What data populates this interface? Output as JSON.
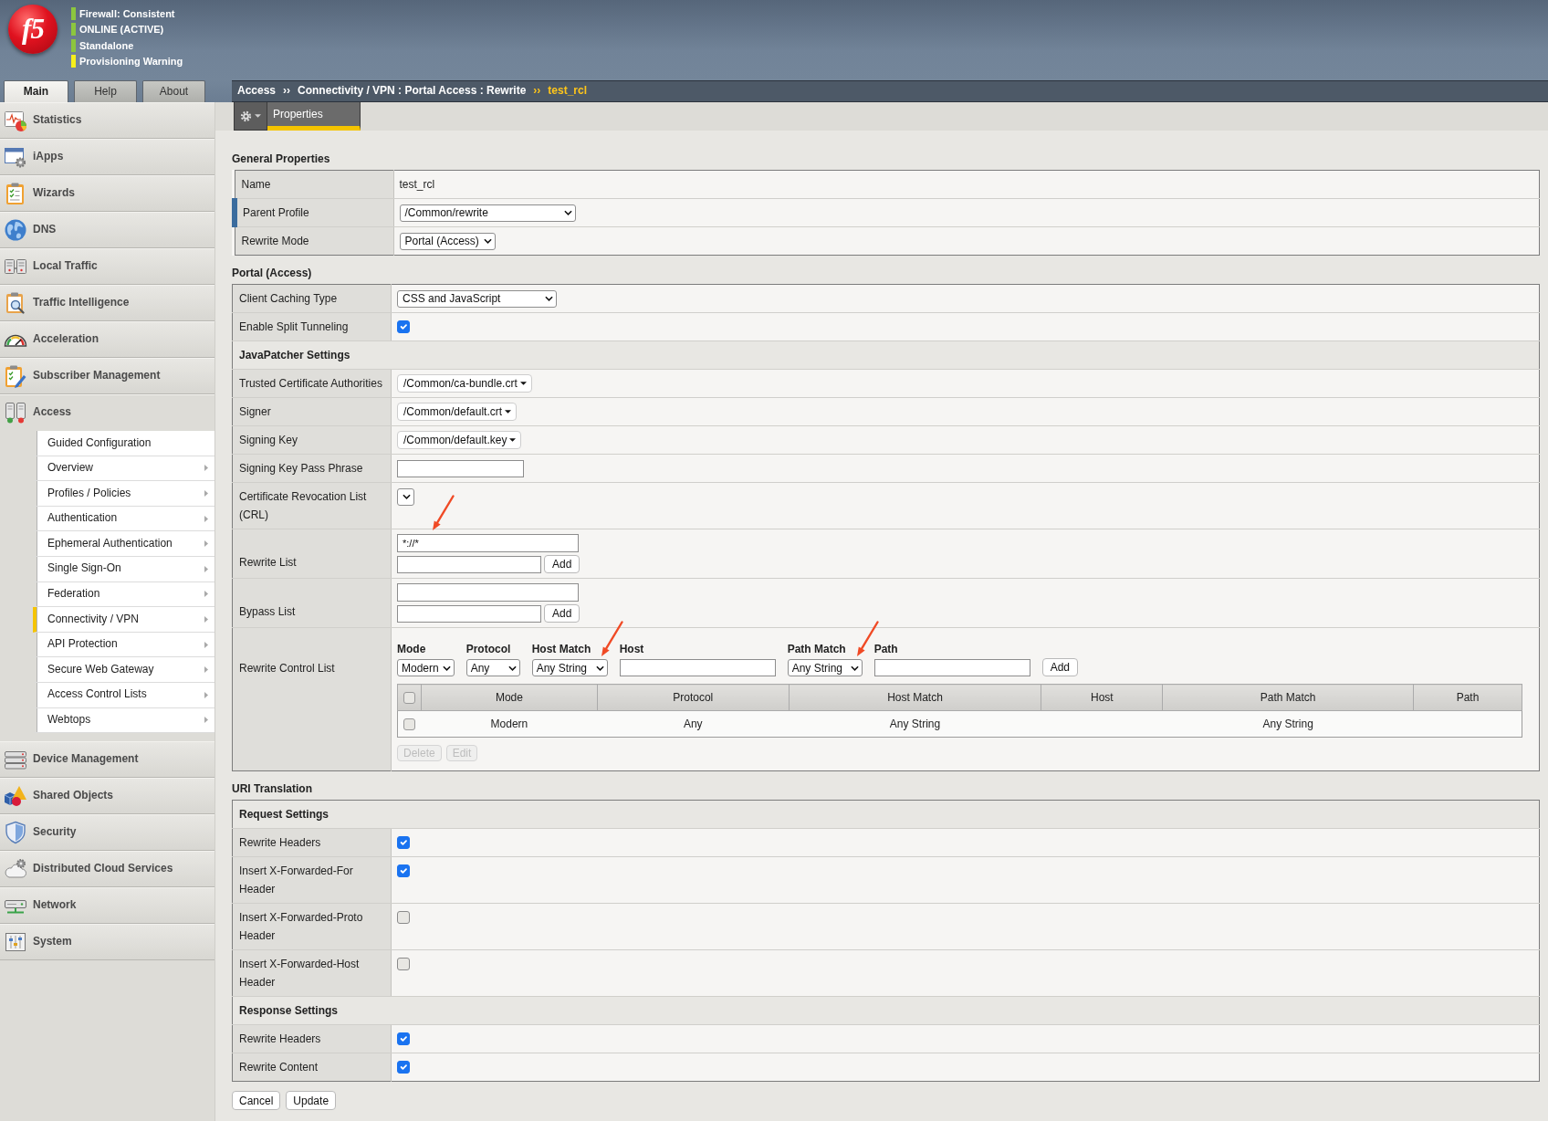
{
  "header": {
    "logo": "f5",
    "status": [
      {
        "text": "Firewall: Consistent",
        "color": "#8cc63e"
      },
      {
        "text": "ONLINE (ACTIVE)",
        "color": "#8cc63e"
      },
      {
        "text": "Standalone",
        "color": "#8cc63e"
      },
      {
        "text": "Provisioning Warning",
        "color": "#f6ef1b"
      }
    ]
  },
  "nav_tabs": [
    {
      "label": "Main",
      "selected": true
    },
    {
      "label": "Help",
      "selected": false
    },
    {
      "label": "About",
      "selected": false
    }
  ],
  "breadcrumb": [
    {
      "label": "Access",
      "current": false
    },
    {
      "separator": "››",
      "label": "Connectivity / VPN : Portal Access : Rewrite",
      "current": false
    },
    {
      "separator": "››",
      "label": "test_rcl",
      "current": true
    }
  ],
  "page_tabs": [
    {
      "label": "Properties",
      "selected": true
    }
  ],
  "sidebar": {
    "items": [
      {
        "label": "Statistics",
        "expanded": false
      },
      {
        "label": "iApps",
        "expanded": false
      },
      {
        "label": "Wizards",
        "expanded": false
      },
      {
        "label": "DNS",
        "expanded": false
      },
      {
        "label": "Local Traffic",
        "expanded": false
      },
      {
        "label": "Traffic Intelligence",
        "expanded": false
      },
      {
        "label": "Acceleration",
        "expanded": false
      },
      {
        "label": "Subscriber Management",
        "expanded": false
      },
      {
        "label": "Access",
        "expanded": true,
        "children": [
          {
            "label": "Guided Configuration",
            "selected": false,
            "has_submenu": false
          },
          {
            "label": "Overview",
            "selected": false,
            "has_submenu": true
          },
          {
            "label": "Profiles / Policies",
            "selected": false,
            "has_submenu": true
          },
          {
            "label": "Authentication",
            "selected": false,
            "has_submenu": true
          },
          {
            "label": "Ephemeral Authentication",
            "selected": false,
            "has_submenu": true
          },
          {
            "label": "Single Sign-On",
            "selected": false,
            "has_submenu": true
          },
          {
            "label": "Federation",
            "selected": false,
            "has_submenu": true
          },
          {
            "label": "Connectivity / VPN",
            "selected": true,
            "has_submenu": true
          },
          {
            "label": "API Protection",
            "selected": false,
            "has_submenu": true
          },
          {
            "label": "Secure Web Gateway",
            "selected": false,
            "has_submenu": true
          },
          {
            "label": "Access Control Lists",
            "selected": false,
            "has_submenu": true
          },
          {
            "label": "Webtops",
            "selected": false,
            "has_submenu": true
          }
        ]
      },
      {
        "label": "Device Management",
        "expanded": false
      },
      {
        "label": "Shared Objects",
        "expanded": false
      },
      {
        "label": "Security",
        "expanded": false
      },
      {
        "label": "Distributed Cloud Services",
        "expanded": false
      },
      {
        "label": "Network",
        "expanded": false
      },
      {
        "label": "System",
        "expanded": false
      }
    ]
  },
  "sections": [
    {
      "title": "General Properties",
      "rows": [
        {
          "kind": "text",
          "label": "Name",
          "value": "test_rcl",
          "highlighted": false
        },
        {
          "kind": "select",
          "label": "Parent Profile",
          "value": "/Common/rewrite",
          "highlighted": true
        },
        {
          "kind": "select",
          "label": "Rewrite Mode",
          "value": "Portal (Access)",
          "highlighted": false
        }
      ]
    },
    {
      "title": "Portal (Access)",
      "rows": [
        {
          "kind": "select",
          "label": "Client Caching Type",
          "value": "CSS and JavaScript"
        },
        {
          "kind": "checkbox",
          "label": "Enable Split Tunneling",
          "checked": true
        },
        {
          "kind": "heading",
          "label": "JavaPatcher Settings"
        },
        {
          "kind": "menu",
          "label": "Trusted Certificate Authorities",
          "value": "/Common/ca-bundle.crt"
        },
        {
          "kind": "menu",
          "label": "Signer",
          "value": "/Common/default.crt"
        },
        {
          "kind": "menu",
          "label": "Signing Key",
          "value": "/Common/default.key"
        },
        {
          "kind": "input",
          "label": "Signing Key Pass Phrase"
        },
        {
          "kind": "select",
          "label": "Certificate Revocation List (CRL)"
        },
        {
          "kind": "list-editor",
          "label": "Rewrite List",
          "entries": [
            {
              "text": "*://*",
              "annotated": true
            }
          ],
          "add_button": "Add"
        },
        {
          "kind": "list-editor",
          "label": "Bypass List",
          "add_button": "Add"
        },
        {
          "kind": "control-list",
          "label": "Rewrite Control List",
          "filters": [
            {
              "kind": "select",
              "label": "Mode",
              "value": "Modern",
              "annotated": false
            },
            {
              "kind": "select",
              "label": "Protocol",
              "value": "Any",
              "annotated": false
            },
            {
              "kind": "select",
              "label": "Host Match",
              "value": "Any String",
              "annotated": true
            },
            {
              "kind": "input",
              "label": "Host",
              "annotated": false
            },
            {
              "kind": "select",
              "label": "Path Match",
              "value": "Any String",
              "annotated": true
            },
            {
              "kind": "input",
              "label": "Path",
              "annotated": false
            }
          ],
          "add_button": "Add",
          "table": {
            "header_checked": false,
            "columns": [
              "Mode",
              "Protocol",
              "Host Match",
              "Host",
              "Path Match",
              "Path"
            ],
            "rows": [
              {
                "checked": false,
                "mode": "Modern",
                "protocol": "Any",
                "host_match": "Any String",
                "path_match": "Any String"
              }
            ]
          },
          "actions": [
            {
              "label": "Delete",
              "disabled": true
            },
            {
              "label": "Edit",
              "disabled": true
            }
          ]
        }
      ]
    },
    {
      "title": "URI Translation",
      "rows": [
        {
          "kind": "heading",
          "label": "Request Settings"
        },
        {
          "kind": "checkbox",
          "label": "Rewrite Headers",
          "checked": true
        },
        {
          "kind": "checkbox",
          "label": "Insert X-Forwarded-For Header",
          "checked": true
        },
        {
          "kind": "checkbox",
          "label": "Insert X-Forwarded-Proto Header",
          "checked": false
        },
        {
          "kind": "checkbox",
          "label": "Insert X-Forwarded-Host Header",
          "checked": false
        },
        {
          "kind": "heading",
          "label": "Response Settings"
        },
        {
          "kind": "checkbox",
          "label": "Rewrite Headers",
          "checked": true
        },
        {
          "kind": "checkbox",
          "label": "Rewrite Content",
          "checked": true
        }
      ]
    }
  ],
  "form_buttons": [
    "Cancel",
    "Update"
  ]
}
